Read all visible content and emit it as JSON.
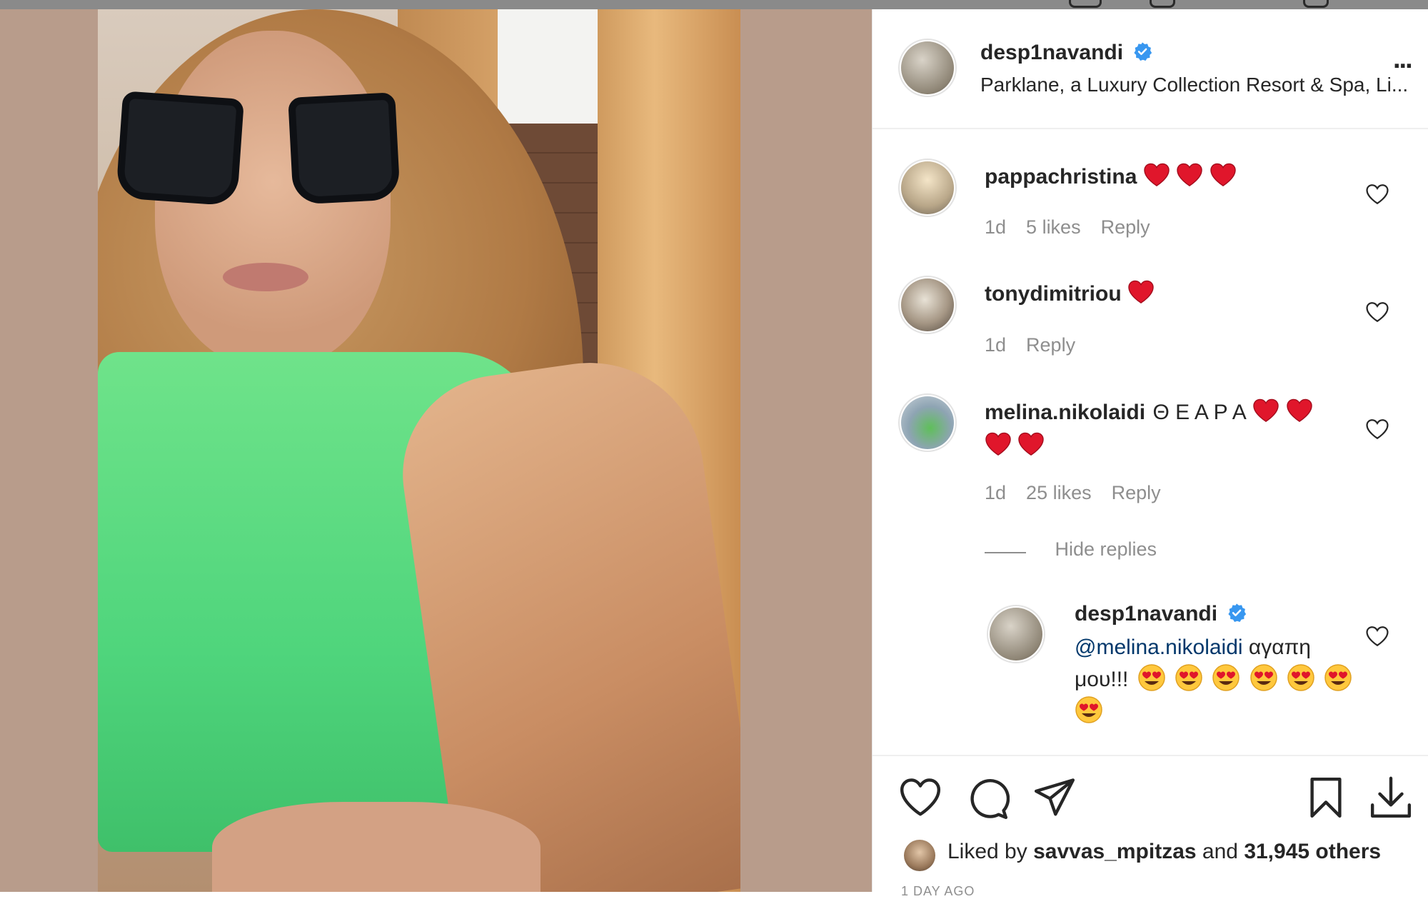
{
  "post": {
    "username": "desp1navandi",
    "location": "Parklane, a Luxury Collection Resort & Spa, Li...",
    "more_label": "..."
  },
  "comments": [
    {
      "username": "pappachristina",
      "text": "",
      "time": "1d",
      "likes": "5 likes",
      "reply": "Reply"
    },
    {
      "username": "tonydimitriou",
      "text": "",
      "time": "1d",
      "reply": "Reply"
    },
    {
      "username": "melina.nikolaidi",
      "text": "Θ Ε Α Ρ Α",
      "time": "1d",
      "likes": "25 likes",
      "reply": "Reply"
    }
  ],
  "hide_replies": "Hide replies",
  "reply": {
    "username": "desp1navandi",
    "mention": "@melina.nikolaidi",
    "text_line1": " αγαπη",
    "text_line2": "μου!!!"
  },
  "likes": {
    "prefix": "Liked by ",
    "user": "savvas_mpitzas",
    "middle": " and ",
    "count": "31,945 others"
  },
  "timestamp": "1 DAY AGO",
  "colors": {
    "verified": "#3897f0",
    "heart_red": "#e0162b",
    "text": "#262626",
    "muted": "#8e8e8e",
    "mention": "#00376b"
  },
  "icons": [
    "verified-icon",
    "more-options-icon",
    "like-comment-icon",
    "like-icon",
    "comment-icon",
    "share-icon",
    "save-icon",
    "download-icon"
  ]
}
